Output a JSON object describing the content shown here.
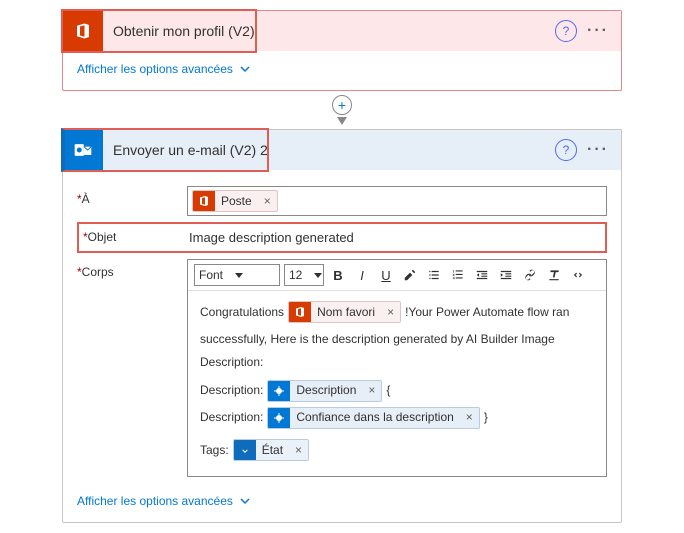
{
  "card1": {
    "title": "Obtenir mon profil (V2)",
    "advanced": "Afficher les options avancées"
  },
  "card2": {
    "title": "Envoyer un e-mail (V2) 2",
    "advanced": "Afficher les options avancées",
    "labels": {
      "to": "À",
      "subject": "Objet",
      "body": "Corps"
    },
    "to_token": "Poste",
    "subject_value": "Image description generated",
    "toolbar": {
      "font": "Font",
      "size": "12"
    },
    "body": {
      "line1a": "Congratulations",
      "token1": "Nom favori",
      "line1b": "!Your Power Automate flow ran",
      "line2": "successfully, Here is the description generated by AI Builder Image",
      "line3": "Description:",
      "desc_label": "Description:",
      "token_desc": "Description",
      "brace_open": "{",
      "token_conf": "Confiance dans la description",
      "brace_close": "}",
      "tags_label": "Tags:",
      "token_state": "État"
    }
  },
  "icons": {
    "remove": "×"
  }
}
